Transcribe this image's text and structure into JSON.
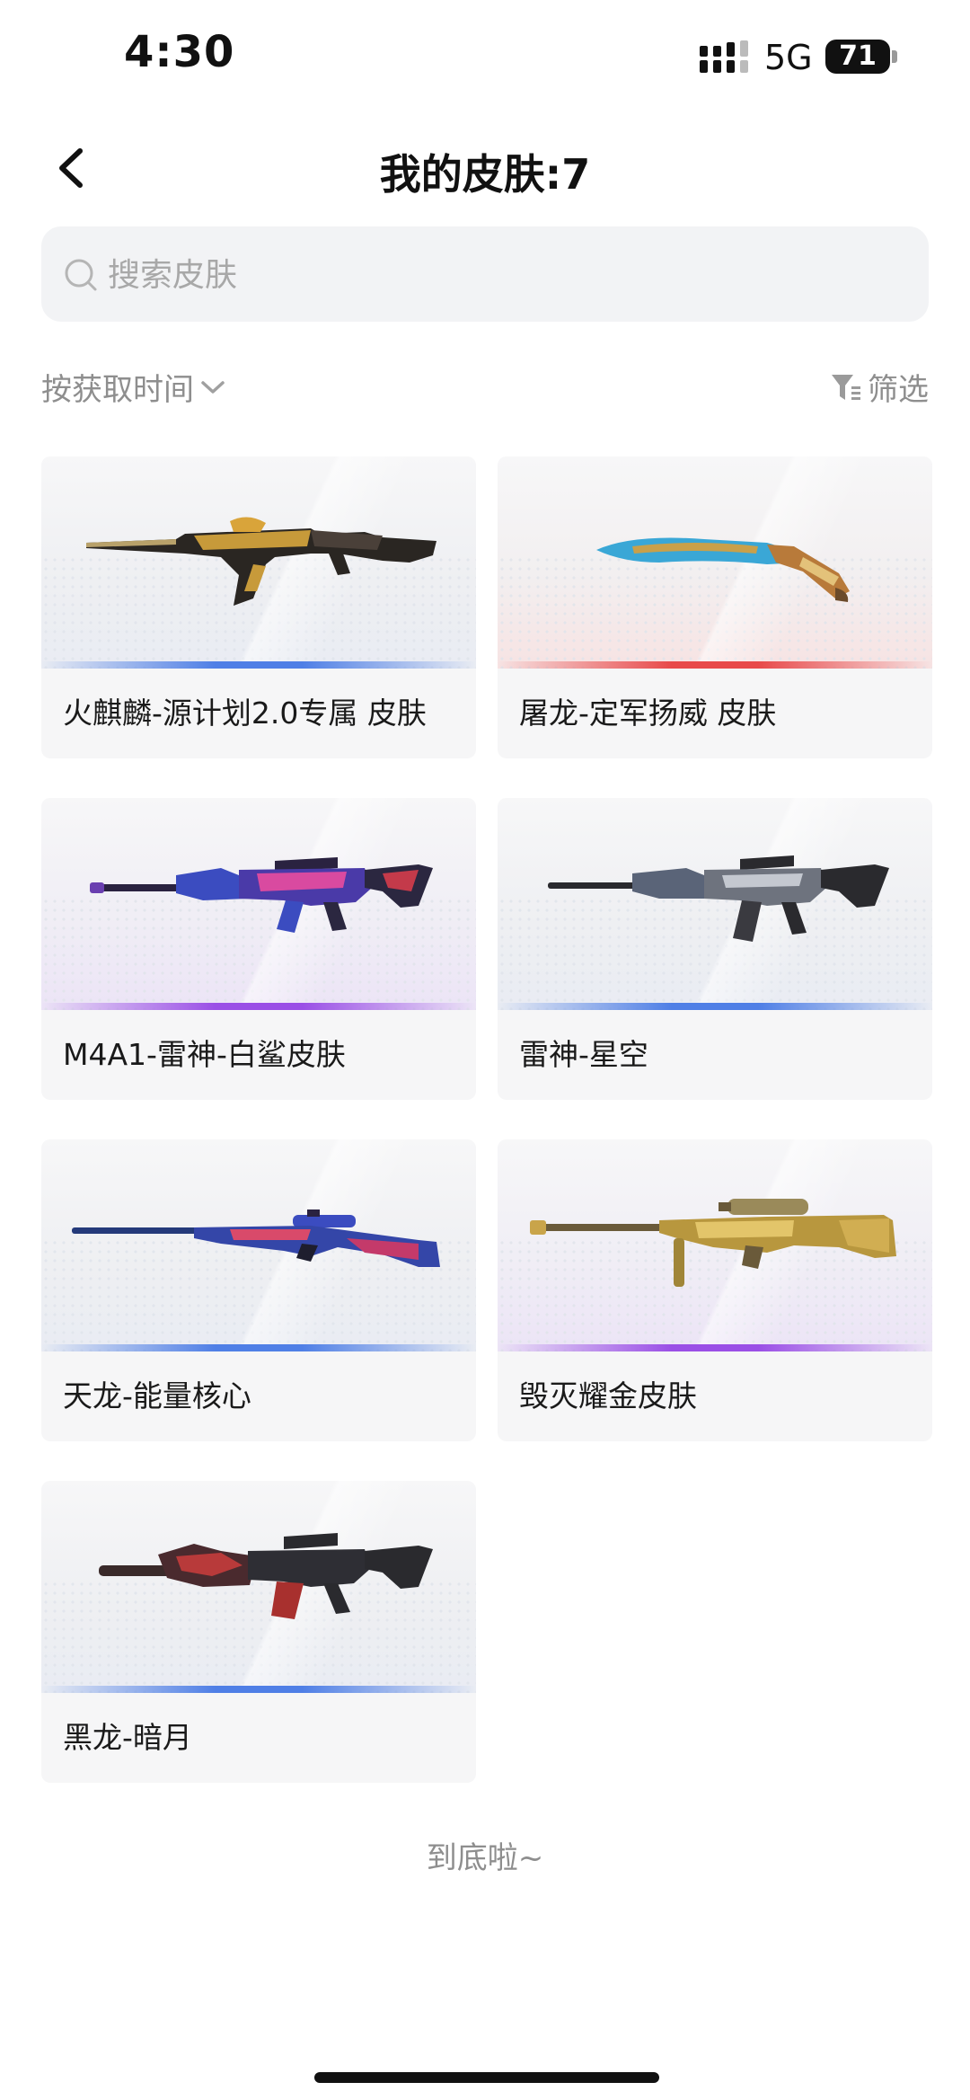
{
  "status": {
    "time": "4:30",
    "network": "5G",
    "battery": "71"
  },
  "header": {
    "title": "我的皮肤:7"
  },
  "search": {
    "placeholder": "搜索皮肤"
  },
  "toolbar": {
    "sort_label": "按获取时间",
    "filter_label": "筛选"
  },
  "skins": [
    {
      "name": "火麒麟-源计划2.0专属 皮肤",
      "bar_color": "#4f7fe6",
      "icon": "rifle-ak-gold-icon"
    },
    {
      "name": "屠龙-定军扬威 皮肤",
      "bar_color": "#e84a4a",
      "icon": "knife-dragon-icon"
    },
    {
      "name": "M4A1-雷神-白鲨皮肤",
      "bar_color": "#9a4fe6",
      "icon": "rifle-m4-purple-icon"
    },
    {
      "name": "雷神-星空",
      "bar_color": "#4f7fe6",
      "icon": "rifle-m4-silver-icon"
    },
    {
      "name": "天龙-能量核心",
      "bar_color": "#4f7fe6",
      "icon": "sniper-awp-blue-icon"
    },
    {
      "name": "毁灭耀金皮肤",
      "bar_color": "#9a4fe6",
      "icon": "sniper-barrett-gold-icon"
    },
    {
      "name": "黑龙-暗月",
      "bar_color": "#4f7fe6",
      "icon": "rifle-m4-red-icon"
    }
  ],
  "footer": {
    "end_text": "到底啦~"
  }
}
